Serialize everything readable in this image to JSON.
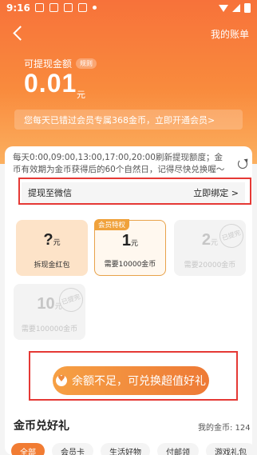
{
  "status_bar": {
    "time": "9:16"
  },
  "header": {
    "my_account": "我的账单"
  },
  "balance": {
    "label": "可提现金额",
    "rules_badge": "规则",
    "amount": "0.01",
    "unit": "元"
  },
  "missed_banner": "您每天已错过会员专属368金币，立即开通会员>",
  "notice": "每天0:00,09:00,13:00,17:00,20:00刷新提现额度；金币有效期为金币获得后的60个自然日，记得尽快兑换喔～",
  "withdraw": {
    "label": "提现至微信",
    "bind_label": "立即绑定 >"
  },
  "tiles": {
    "redpack": {
      "value": "?",
      "unit": "元",
      "caption": "拆现金红包"
    },
    "member": {
      "tag": "会员特权",
      "value": "1",
      "unit": "元",
      "caption": "需要10000金币"
    },
    "t20": {
      "value": "2",
      "unit": "元",
      "caption": "需要20000金币",
      "stamp": "已提完"
    },
    "t10": {
      "value": "10",
      "unit": "元",
      "caption": "需要100000金币",
      "stamp": "已提完"
    }
  },
  "exchange_button": "余额不足，可兑换超值好礼",
  "gift_section": {
    "title": "金币兑好礼",
    "my_coins": "我的金币: 124"
  },
  "tabs": [
    "全部",
    "会员卡",
    "生活好物",
    "付邮领",
    "游戏礼包"
  ]
}
